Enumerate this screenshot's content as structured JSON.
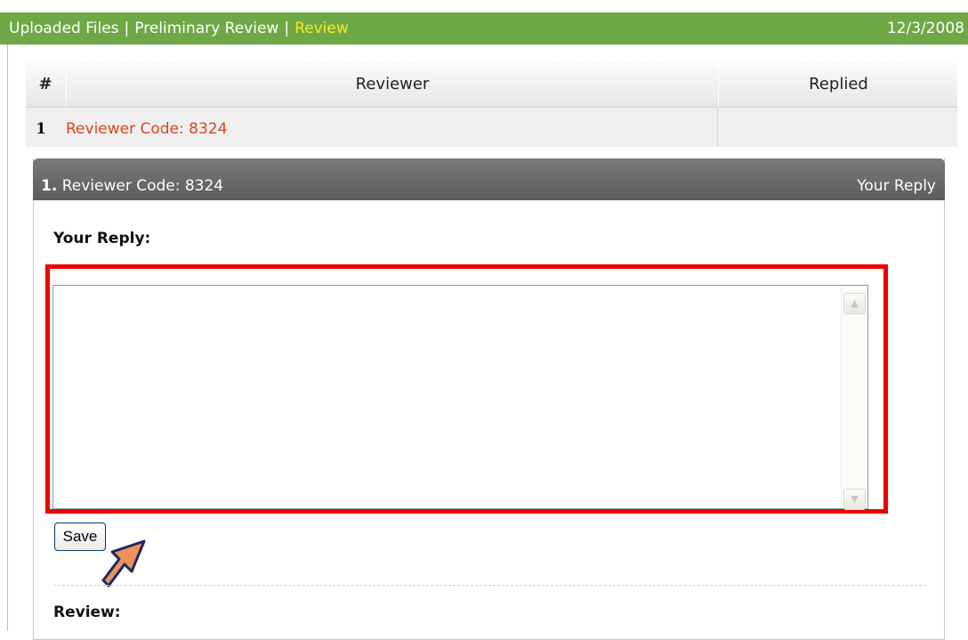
{
  "nav": {
    "crumbs": [
      "Uploaded Files",
      "Preliminary Review",
      "Review"
    ],
    "separator": "|",
    "date": "12/3/2008"
  },
  "table": {
    "headers": {
      "num": "#",
      "reviewer": "Reviewer",
      "replied": "Replied"
    },
    "rows": [
      {
        "num": "1",
        "reviewer": "Reviewer Code: 8324",
        "replied": ""
      }
    ]
  },
  "panel": {
    "title_num": "1.",
    "title": "Reviewer Code: 8324",
    "right_label": "Your Reply",
    "reply_label": "Your Reply:",
    "reply_value": "",
    "save_label": "Save",
    "review_label": "Review:"
  },
  "colors": {
    "nav_green": "#6fa847",
    "active_crumb": "#f4ea2a",
    "link_orange": "#e0441b",
    "highlight_red": "#ee0000",
    "panel_header": "#666666"
  },
  "icons": {
    "pointer": "pointer-arrow-icon",
    "scroll_up": "scroll-up-icon",
    "scroll_down": "scroll-down-icon"
  }
}
